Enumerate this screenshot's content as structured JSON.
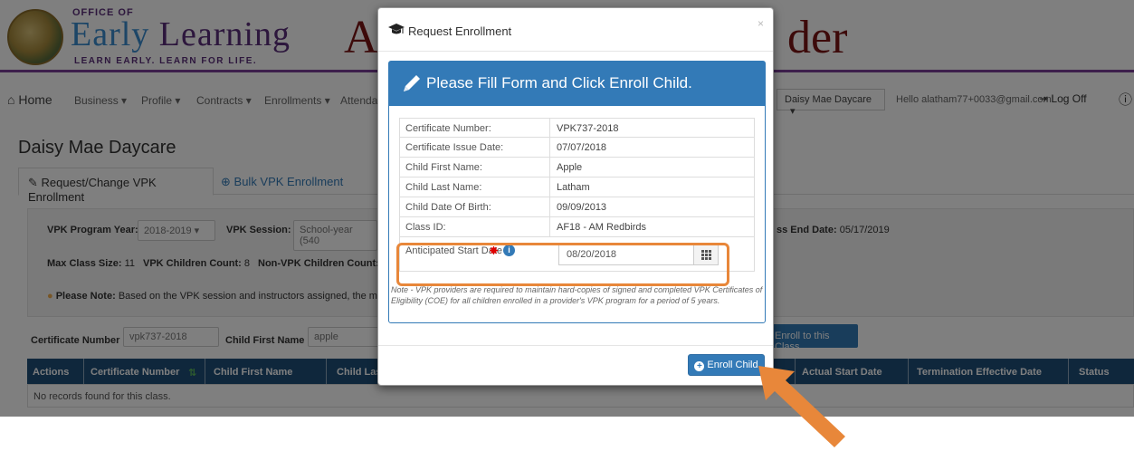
{
  "header": {
    "logo_office": "OFFICE OF",
    "logo_main_a": "Early ",
    "logo_main_b": "Learning",
    "logo_tagline": "LEARN EARLY. LEARN FOR LIFE.",
    "title_left": "A",
    "title_right": "der"
  },
  "nav": {
    "home": "Home",
    "business": "Business",
    "profile": "Profile",
    "contracts": "Contracts",
    "enrollments": "Enrollments",
    "attendance": "Attenda",
    "provider_select": "Daisy Mae Daycare",
    "hello": "Hello alatham77+0033@gmail.com!",
    "logoff": "Log Off"
  },
  "page": {
    "title": "Daisy Mae Daycare",
    "tab_active": "Request/Change VPK Enrollment",
    "tab_inactive": "Bulk VPK Enrollment"
  },
  "form": {
    "program_year_label": "VPK Program Year:",
    "program_year_value": "2018-2019",
    "session_label": "VPK Session:",
    "session_value": "School-year (540",
    "class_end_label": "ss End Date:",
    "class_end_value": "05/17/2019",
    "max_class_size_label": "Max Class Size:",
    "max_class_size_value": "11",
    "vpk_children_label": "VPK Children Count:",
    "vpk_children_value": "8",
    "non_vpk_label": "Non-VPK Children Count:",
    "note_bold": "Please Note:",
    "note_text": "Based on the VPK session and instructors assigned, the maxim",
    "cert_search_label": "Certificate Number :",
    "cert_search_value": "vpk737-2018",
    "child_first_label": "Child First Name :",
    "child_first_value": "apple",
    "enroll_class_button": "Enroll to this Class"
  },
  "table": {
    "headers": {
      "actions": "Actions",
      "cert": "Certificate Number",
      "first": "Child First Name",
      "last": "Child Las",
      "actual_start": "Actual Start Date",
      "termination": "Termination Effective Date",
      "status": "Status"
    },
    "empty": "No records found for this class."
  },
  "modal": {
    "title": "Request Enrollment",
    "close": "×",
    "panel_title": "Please Fill Form and Click Enroll Child.",
    "rows": [
      {
        "label": "Certificate Number:",
        "value": "VPK737-2018"
      },
      {
        "label": "Certificate Issue Date:",
        "value": "07/07/2018"
      },
      {
        "label": "Child First Name:",
        "value": "Apple"
      },
      {
        "label": "Child Last Name:",
        "value": "Latham"
      },
      {
        "label": "Child Date Of Birth:",
        "value": "09/09/2013"
      },
      {
        "label": "Class ID:",
        "value": "AF18 - AM Redbirds"
      }
    ],
    "start_label": "Anticipated Start Date",
    "start_value": "08/20/2018",
    "note": "Note - VPK providers are required to maintain hard-copies of signed and completed VPK Certificates of Eligibility (COE) for all children enrolled in a provider's VPK program for a period of 5 years.",
    "enroll_button": "Enroll Child"
  },
  "colors": {
    "primary": "#337ab7",
    "header_dark": "#1f4e79",
    "highlight": "#e8873a",
    "brand_purple": "#5b2e7a"
  }
}
